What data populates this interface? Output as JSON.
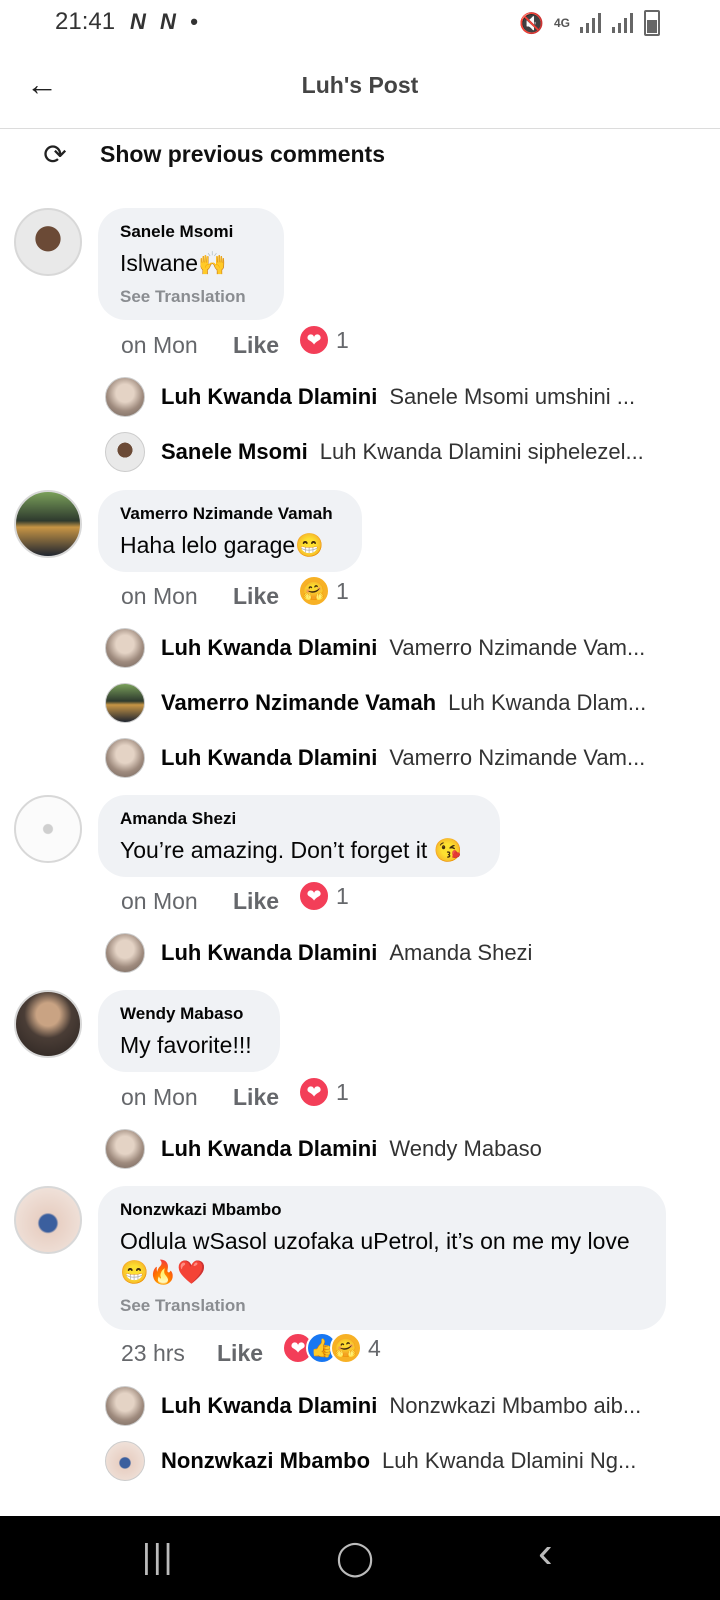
{
  "status": {
    "time": "21:41",
    "left_icons": "N N •",
    "network": "4G"
  },
  "header": {
    "title": "Luh's Post"
  },
  "prev_comments": {
    "label": "Show previous comments"
  },
  "comments": [
    {
      "name": "Sanele Msomi",
      "text": "Islwane🙌",
      "see_translation": "See Translation",
      "time": "on Mon",
      "like": "Like",
      "reaction_count": "1",
      "replies": [
        {
          "name": "Luh Kwanda Dlamini",
          "text": "Sanele Msomi umshini ..."
        },
        {
          "name": "Sanele Msomi",
          "text": "Luh Kwanda Dlamini siphelezel..."
        }
      ]
    },
    {
      "name": "Vamerro Nzimande Vamah",
      "text": "Haha lelo garage😁",
      "time": "on Mon",
      "like": "Like",
      "reaction_count": "1",
      "replies": [
        {
          "name": "Luh Kwanda Dlamini",
          "text": "Vamerro Nzimande Vam..."
        },
        {
          "name": "Vamerro Nzimande Vamah",
          "text": "Luh Kwanda Dlam..."
        },
        {
          "name": "Luh Kwanda Dlamini",
          "text": "Vamerro Nzimande Vam..."
        }
      ]
    },
    {
      "name": "Amanda Shezi",
      "text": "You’re amazing. Don’t forget it 😘",
      "time": "on Mon",
      "like": "Like",
      "reaction_count": "1",
      "replies": [
        {
          "name": "Luh Kwanda Dlamini",
          "text": "Amanda Shezi"
        }
      ]
    },
    {
      "name": "Wendy Mabaso",
      "text": "My favorite!!!",
      "time": "on Mon",
      "like": "Like",
      "reaction_count": "1",
      "replies": [
        {
          "name": "Luh Kwanda Dlamini",
          "text": "Wendy Mabaso"
        }
      ]
    },
    {
      "name": "Nonzwkazi Mbambo",
      "text": "Odlula wSasol uzofaka uPetrol, it’s on me my love 😁🔥❤️",
      "see_translation": "See Translation",
      "time": "23 hrs",
      "like": "Like",
      "reaction_count": "4",
      "replies": [
        {
          "name": "Luh Kwanda Dlamini",
          "text": "Nonzwkazi Mbambo aib..."
        },
        {
          "name": "Nonzwkazi Mbambo",
          "text": "Luh Kwanda Dlamini Ng..."
        }
      ]
    }
  ],
  "icons": {
    "back": "←",
    "refresh": "⟳",
    "love": "❤",
    "like": "👍",
    "care": "🤗",
    "nav_recent": "|||",
    "nav_home": "◯",
    "nav_back": "‹"
  },
  "colors": {
    "love": "#f33e58",
    "like": "#1877f2",
    "care": "#f7b125",
    "bubble": "#f0f2f5"
  }
}
